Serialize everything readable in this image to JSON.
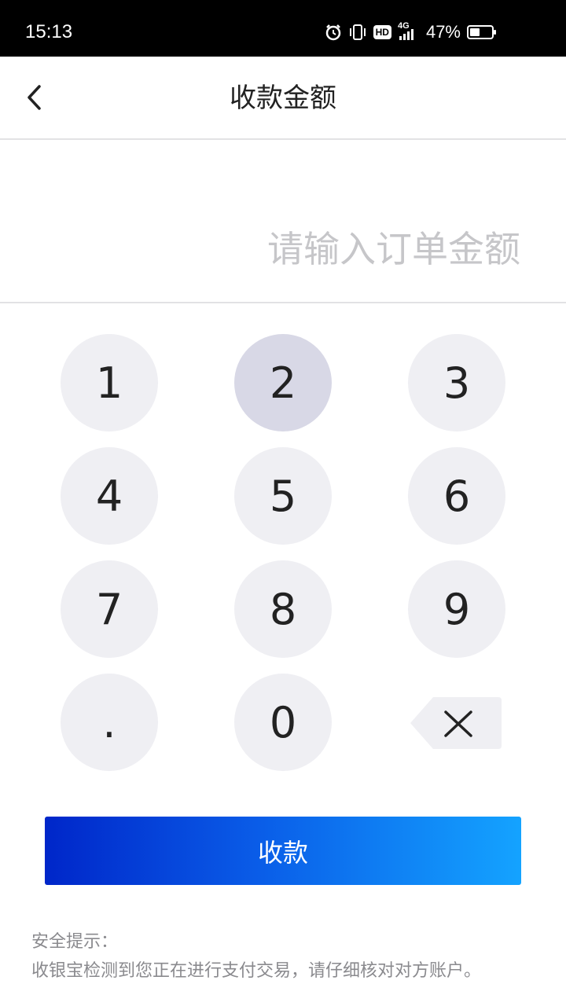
{
  "status_bar": {
    "time": "15:13",
    "hd_label": "HD",
    "network_label": "4G",
    "battery_percent": "47%",
    "battery_level": 0.47,
    "icons": [
      "alarm-icon",
      "vibrate-icon",
      "hd-icon",
      "signal-icon",
      "battery-icon"
    ]
  },
  "header": {
    "title": "收款金额",
    "back_icon": "chevron-left-icon"
  },
  "amount": {
    "value": "",
    "placeholder": "请输入订单金额"
  },
  "keypad": {
    "keys": [
      "1",
      "2",
      "3",
      "4",
      "5",
      "6",
      "7",
      "8",
      "9",
      ".",
      "0"
    ],
    "pressed_key": "2",
    "delete_icon": "backspace-icon"
  },
  "actions": {
    "submit_label": "收款"
  },
  "tips": {
    "title": "安全提示：",
    "body": "收银宝检测到您正在进行支付交易，请仔细核对对方账户。"
  },
  "colors": {
    "button_gradient_start": "#0026c9",
    "button_gradient_end": "#14a3ff",
    "key_background": "#efeff3",
    "key_pressed_background": "#d8d8e6",
    "placeholder": "#c6c6c9"
  }
}
